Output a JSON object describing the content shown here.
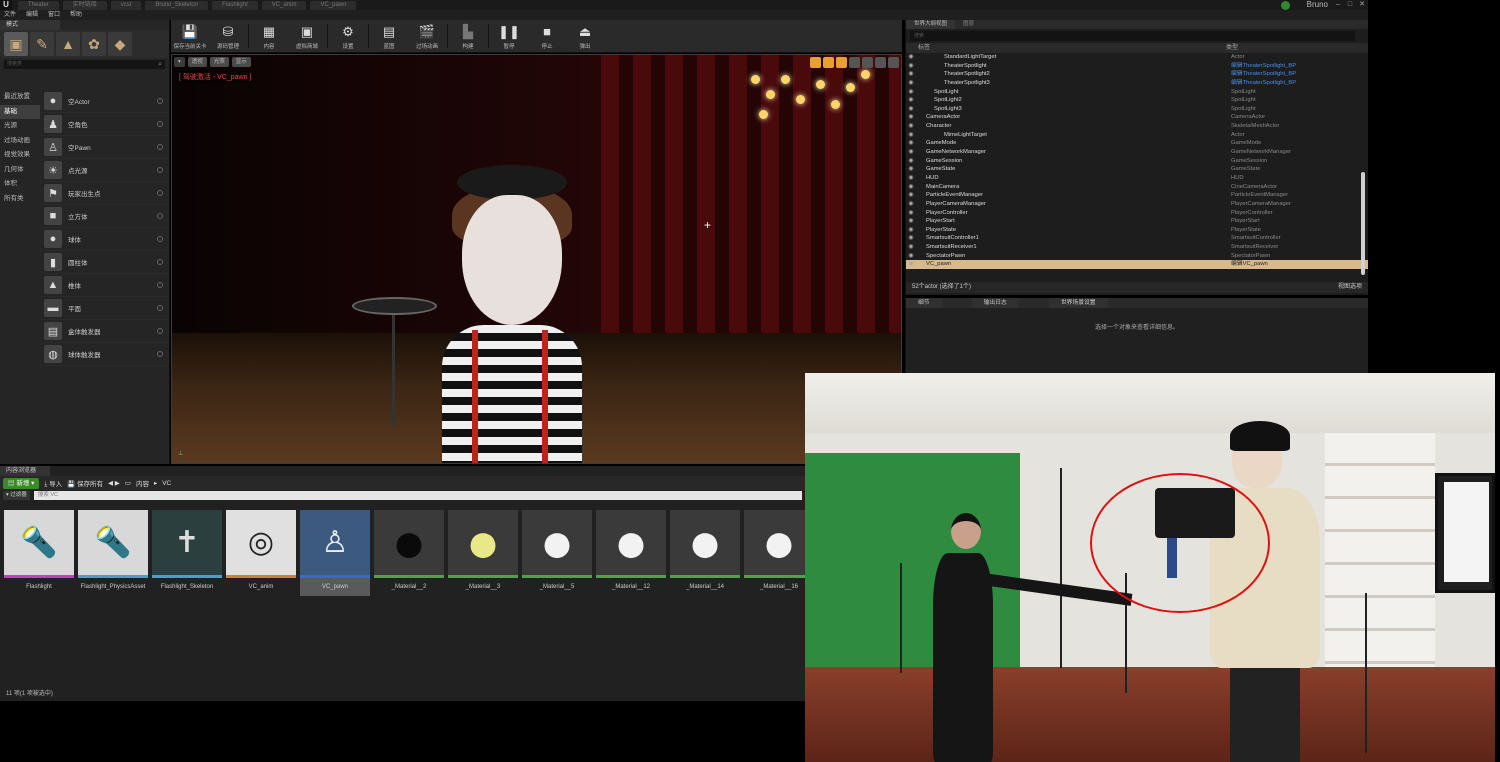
{
  "tabbar": {
    "tabs": [
      "Theater",
      "实时链接",
      "vcst",
      "Bruno_Skeleton",
      "Flashlight",
      "VC_anim",
      "VC_pawn"
    ],
    "user": "Bruno"
  },
  "menubar": [
    "文件",
    "编辑",
    "窗口",
    "帮助"
  ],
  "modes": {
    "tab": "模式",
    "search_placeholder": "搜索类",
    "categories": [
      "最近放置",
      "基础",
      "光源",
      "过场动画",
      "视觉效果",
      "几何体",
      "体积",
      "所有类"
    ],
    "active_category": "基础",
    "items": [
      "空Actor",
      "空角色",
      "空Pawn",
      "点光源",
      "玩家出生点",
      "立方体",
      "球体",
      "圆柱体",
      "椎体",
      "平面",
      "盒体触发器",
      "球体触发器"
    ]
  },
  "toolbar": {
    "buttons": [
      "保存当前关卡",
      "源码管理",
      "内容",
      "虚拟商城",
      "设置",
      "蓝图",
      "过场动画",
      "构建",
      "暂停",
      "停止",
      "弹出"
    ]
  },
  "viewport": {
    "top_buttons": [
      "透视",
      "光照",
      "显示"
    ],
    "sim_label": "[ 驾驶激活 - VC_pawn ]"
  },
  "outliner": {
    "tabs": [
      "世界大纲视图",
      "图层"
    ],
    "search_placeholder": "搜索",
    "col_label": "标签",
    "col_type": "类型",
    "rows": [
      {
        "name": "StandardLightTarget",
        "type": "Actor",
        "link": false
      },
      {
        "name": "TheaterSpotlight",
        "type": "编辑TheaterSpotlight_BP",
        "link": true
      },
      {
        "name": "TheaterSpotlight2",
        "type": "编辑TheaterSpotlight_BP",
        "link": true
      },
      {
        "name": "TheaterSpotlight3",
        "type": "编辑TheaterSpotlight_BP",
        "link": true
      },
      {
        "name": "SpotLight",
        "type": "SpotLight",
        "link": false
      },
      {
        "name": "SpotLight2",
        "type": "SpotLight",
        "link": false
      },
      {
        "name": "SpotLight3",
        "type": "SpotLight",
        "link": false
      },
      {
        "name": "CameraActor",
        "type": "CameraActor",
        "link": false
      },
      {
        "name": "Character",
        "type": "SkeletalMeshActor",
        "link": false
      },
      {
        "name": "MimeLightTarget",
        "type": "Actor",
        "link": false
      },
      {
        "name": "GameMode",
        "type": "GameMode",
        "link": false
      },
      {
        "name": "GameNetworkManager",
        "type": "GameNetworkManager",
        "link": false
      },
      {
        "name": "GameSession",
        "type": "GameSession",
        "link": false
      },
      {
        "name": "GameState",
        "type": "GameState",
        "link": false
      },
      {
        "name": "HUD",
        "type": "HUD",
        "link": false
      },
      {
        "name": "MainCamera",
        "type": "CineCameraActor",
        "link": false
      },
      {
        "name": "ParticleEventManager",
        "type": "ParticleEventManager",
        "link": false
      },
      {
        "name": "PlayerCameraManager",
        "type": "PlayerCameraManager",
        "link": false
      },
      {
        "name": "PlayerController",
        "type": "PlayerController",
        "link": false
      },
      {
        "name": "PlayerStart",
        "type": "PlayerStart",
        "link": false
      },
      {
        "name": "PlayerState",
        "type": "PlayerState",
        "link": false
      },
      {
        "name": "SmartsuitController1",
        "type": "SmartsuitController",
        "link": false
      },
      {
        "name": "SmartsuitReceiver1",
        "type": "SmartsuitReceiver",
        "link": false
      },
      {
        "name": "SpectatorPawn",
        "type": "SpectatorPawn",
        "link": false
      },
      {
        "name": "VC_pawn",
        "type": "编辑VC_pawn",
        "link": true,
        "selected": true
      }
    ],
    "status": "52个actor (选择了1个)",
    "view_options": "视图选项"
  },
  "details": {
    "tabs": [
      "细节",
      "输出日志",
      "世界场景设置"
    ],
    "message": "选择一个对象来查看详细信息。"
  },
  "content_browser": {
    "tab": "内容浏览器",
    "new_label": "新增",
    "import_label": "导入",
    "save_all_label": "保存所有",
    "path": [
      "内容",
      "VC"
    ],
    "filter_label": "过滤器",
    "search_placeholder": "搜索 VC",
    "assets": [
      {
        "name": "Flashlight",
        "color": "#c040c0"
      },
      {
        "name": "Flashlight_PhysicsAsset",
        "color": "#4aa0c0"
      },
      {
        "name": "Flashlight_Skeleton",
        "color": "#4aa0c0"
      },
      {
        "name": "VC_anim",
        "color": "#d08030"
      },
      {
        "name": "VC_pawn",
        "color": "#3a6ad0",
        "selected": true
      },
      {
        "name": "_Material__2",
        "color": "#50a050"
      },
      {
        "name": "_Material__3",
        "color": "#50a050"
      },
      {
        "name": "_Material__5",
        "color": "#50a050"
      },
      {
        "name": "_Material__12",
        "color": "#50a050"
      },
      {
        "name": "_Material__14",
        "color": "#50a050"
      },
      {
        "name": "_Material__16",
        "color": "#50a050"
      }
    ],
    "count": "11 项(1 项被选中)"
  }
}
